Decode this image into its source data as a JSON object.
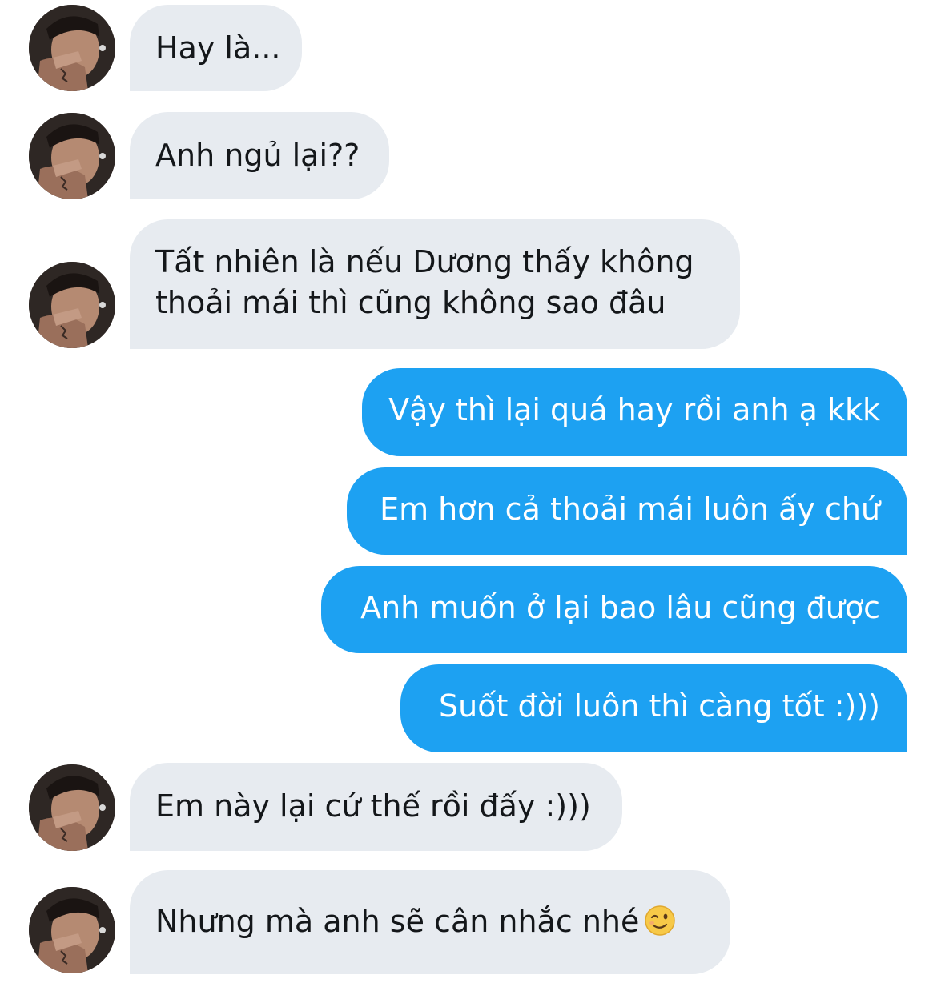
{
  "colors": {
    "incoming_bubble": "#e7ebf0",
    "outgoing_bubble": "#1da1f2",
    "incoming_text": "#14171a",
    "outgoing_text": "#ffffff"
  },
  "messages": [
    {
      "direction": "incoming",
      "text": "Hay là..."
    },
    {
      "direction": "incoming",
      "text": "Anh ngủ lại??"
    },
    {
      "direction": "incoming",
      "lines": [
        "Tất nhiên là nếu Dương thấy không",
        "thoải mái thì cũng không sao đâu"
      ]
    },
    {
      "direction": "outgoing",
      "text": "Vậy thì lại quá hay rồi anh ạ kkk"
    },
    {
      "direction": "outgoing",
      "text": "Em hơn cả thoải mái luôn ấy chứ"
    },
    {
      "direction": "outgoing",
      "text": "Anh muốn ở lại bao lâu cũng được"
    },
    {
      "direction": "outgoing",
      "text": "Suốt đời luôn thì càng tốt :)))"
    },
    {
      "direction": "incoming",
      "text": "Em này lại cứ thế rồi đấy :)))"
    },
    {
      "direction": "incoming",
      "text": "Nhưng mà anh sẽ cân nhắc nhé",
      "emoji": "winking-face-emoji"
    }
  ]
}
